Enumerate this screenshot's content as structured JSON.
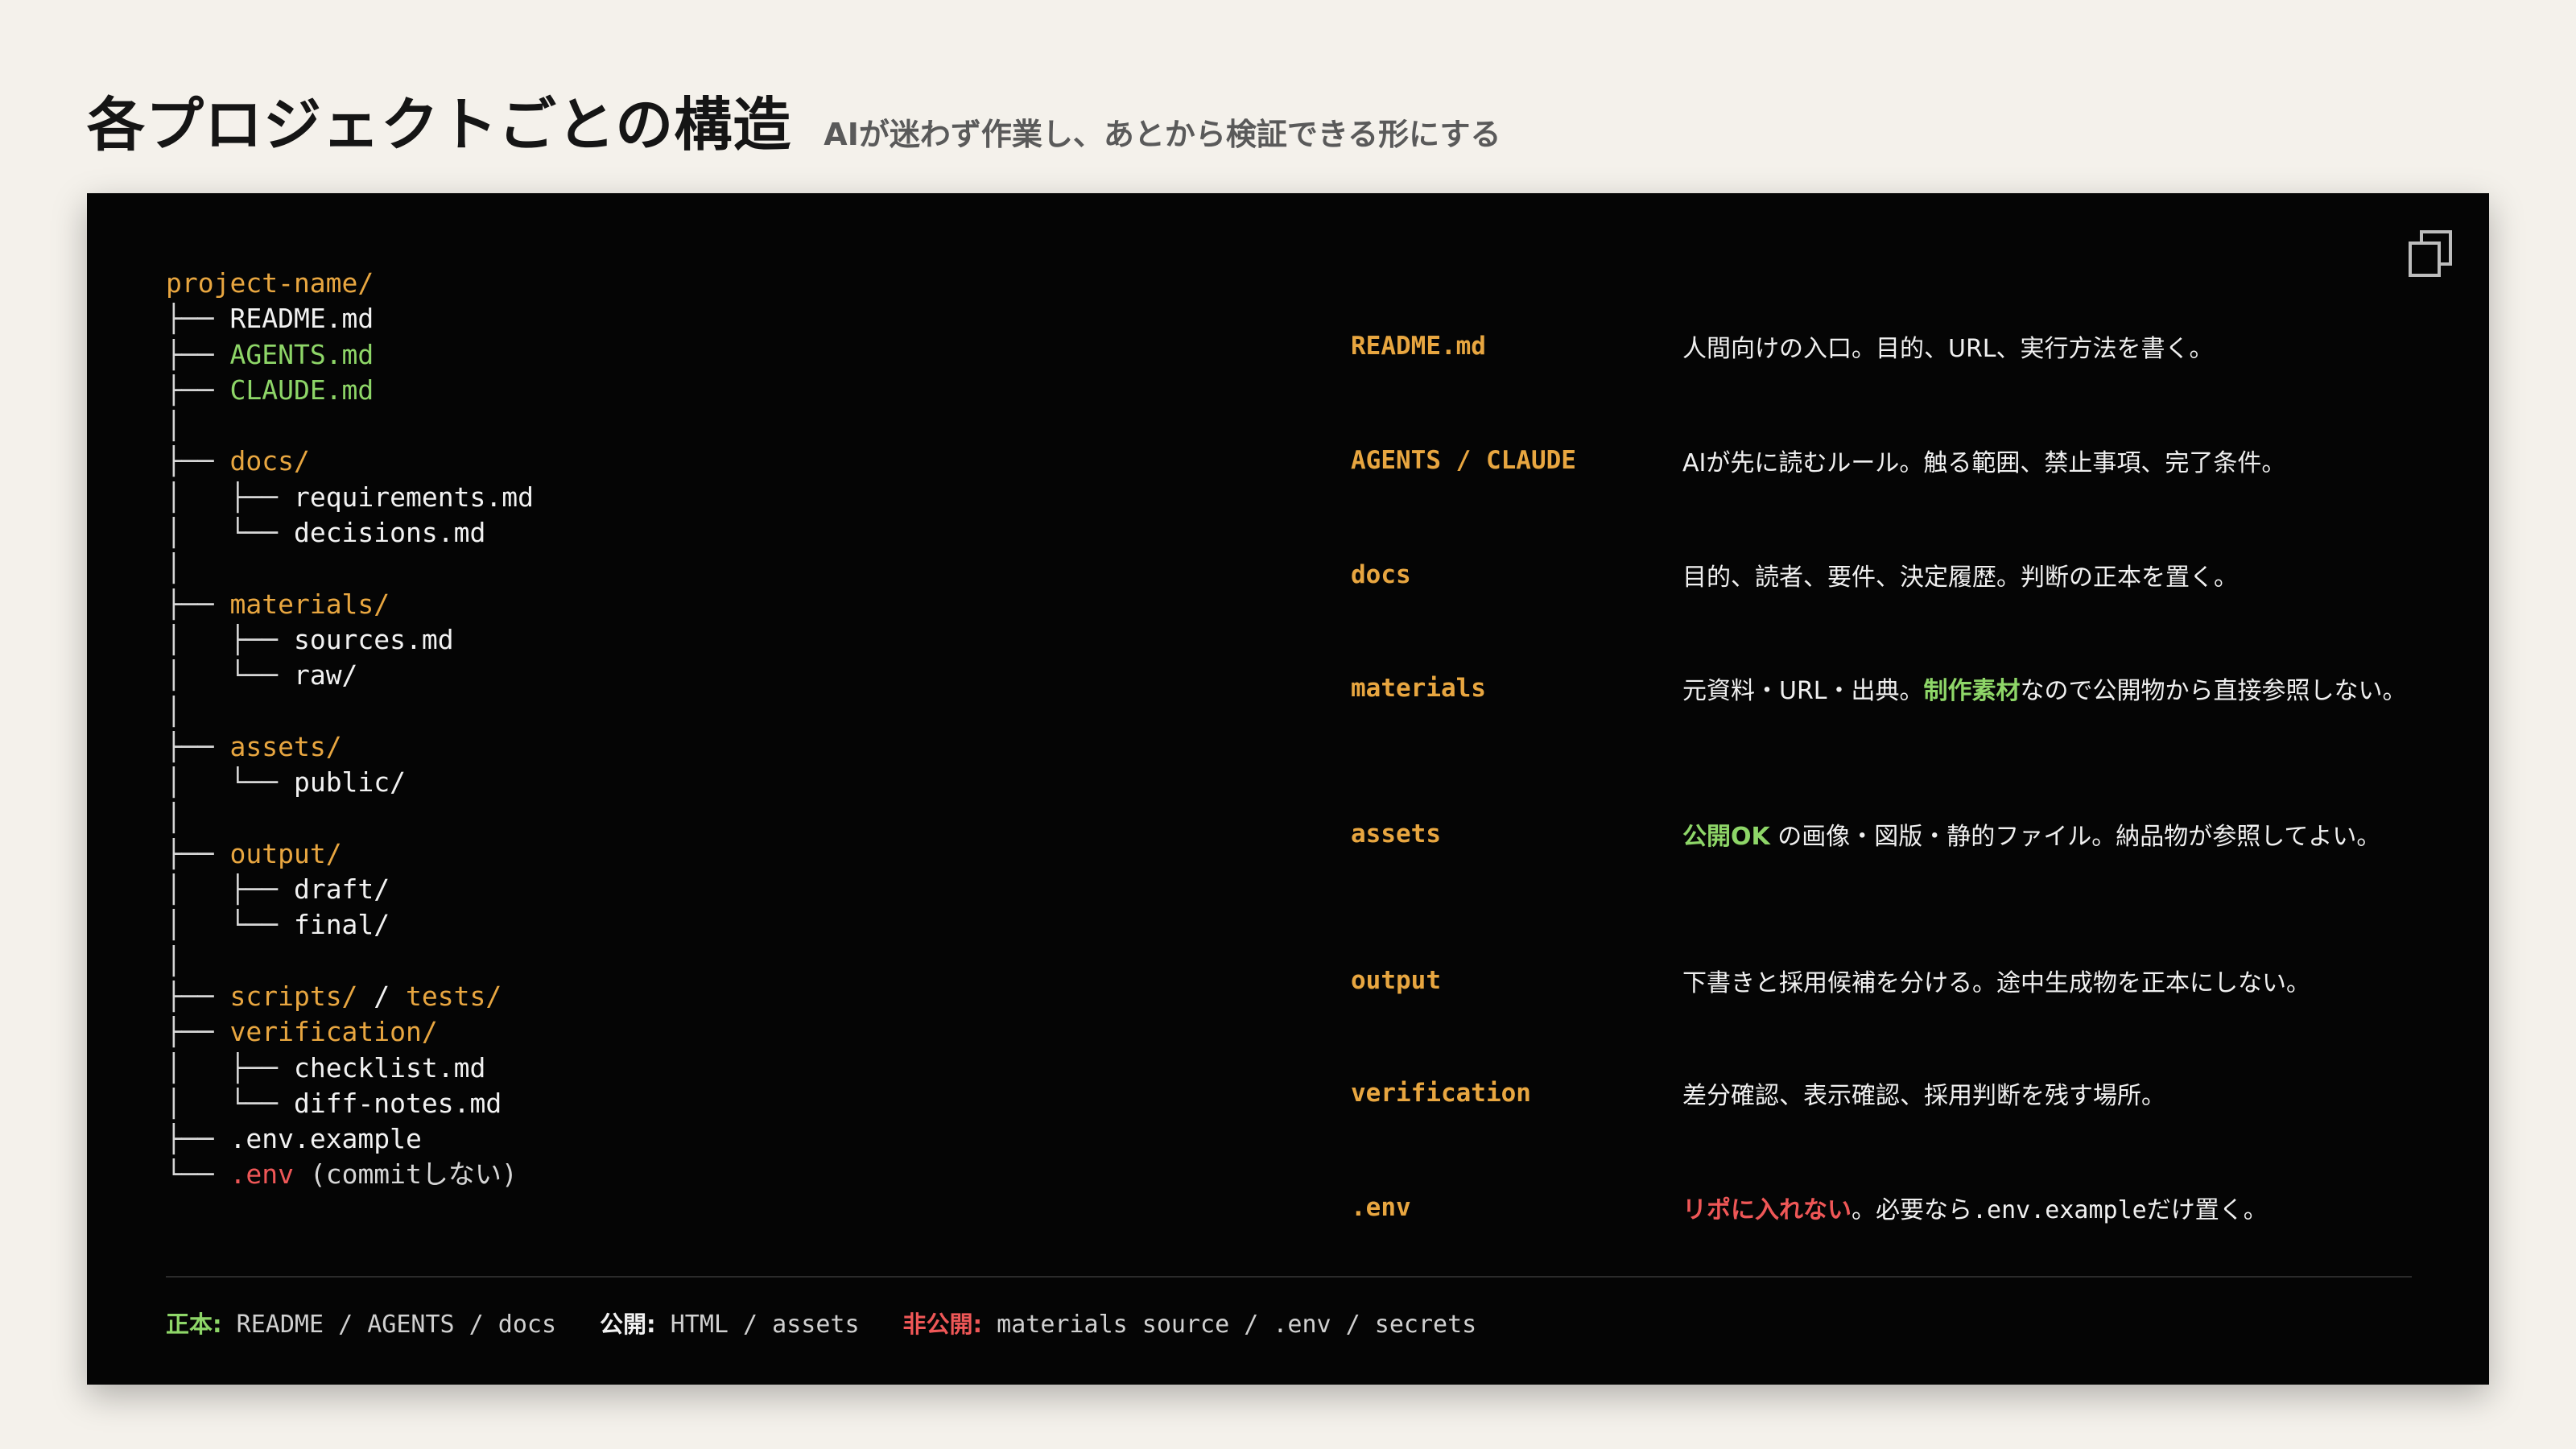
{
  "title": "各プロジェクトごとの構造",
  "subtitle": "AIが迷わず作業し、あとから検証できる形にする",
  "copy_icon": "copy-icon",
  "tree": [
    {
      "prefix": "",
      "name": "project-name/",
      "color": "orange"
    },
    {
      "prefix": "├── ",
      "name": "README.md",
      "color": "white"
    },
    {
      "prefix": "├── ",
      "name": "AGENTS.md",
      "color": "green"
    },
    {
      "prefix": "├── ",
      "name": "CLAUDE.md",
      "color": "green"
    },
    {
      "prefix": "│",
      "name": "",
      "color": "white"
    },
    {
      "prefix": "├── ",
      "name": "docs/",
      "color": "orange"
    },
    {
      "prefix": "│   ├── ",
      "name": "requirements.md",
      "color": "white"
    },
    {
      "prefix": "│   └── ",
      "name": "decisions.md",
      "color": "white"
    },
    {
      "prefix": "│",
      "name": "",
      "color": "white"
    },
    {
      "prefix": "├── ",
      "name": "materials/",
      "color": "orange"
    },
    {
      "prefix": "│   ├── ",
      "name": "sources.md",
      "color": "white"
    },
    {
      "prefix": "│   └── ",
      "name": "raw/",
      "color": "white"
    },
    {
      "prefix": "│",
      "name": "",
      "color": "white"
    },
    {
      "prefix": "├── ",
      "name": "assets/",
      "color": "orange"
    },
    {
      "prefix": "│   └── ",
      "name": "public/",
      "color": "white"
    },
    {
      "prefix": "│",
      "name": "",
      "color": "white"
    },
    {
      "prefix": "├── ",
      "name": "output/",
      "color": "orange"
    },
    {
      "prefix": "│   ├── ",
      "name": "draft/",
      "color": "white"
    },
    {
      "prefix": "│   └── ",
      "name": "final/",
      "color": "white"
    },
    {
      "prefix": "│",
      "name": "",
      "color": "white"
    },
    {
      "prefix": "├── ",
      "name": "scripts/",
      "color": "orange",
      "sep": " / ",
      "name2": "tests/"
    },
    {
      "prefix": "├── ",
      "name": "verification/",
      "color": "orange"
    },
    {
      "prefix": "│   ├── ",
      "name": "checklist.md",
      "color": "white"
    },
    {
      "prefix": "│   └── ",
      "name": "diff-notes.md",
      "color": "white"
    },
    {
      "prefix": "├── ",
      "name": ".env.example",
      "color": "white"
    },
    {
      "prefix": "└── ",
      "name": ".env",
      "color": "red",
      "suffix": " (commitしない)"
    }
  ],
  "descriptions": [
    {
      "key": "README.md",
      "parts": [
        {
          "t": "人間向けの入口。目的、URL、実行方法を書く。"
        }
      ]
    },
    {
      "key": "AGENTS / CLAUDE",
      "parts": [
        {
          "t": "AIが先に読むルール。触る範囲、禁止事項、完了条件。"
        }
      ]
    },
    {
      "key": "docs",
      "parts": [
        {
          "t": "目的、読者、要件、決定履歴。判断の正本を置く。"
        }
      ]
    },
    {
      "key": "materials",
      "parts": [
        {
          "t": "元資料・URL・出典。"
        },
        {
          "t": "制作素材",
          "s": "green"
        },
        {
          "t": "なので公開物から直接参照しない。"
        }
      ]
    },
    {
      "key": "assets",
      "parts": [
        {
          "t": "公開OK",
          "s": "green"
        },
        {
          "t": " の画像・図版・静的ファイル。納品物が参照してよい。"
        }
      ]
    },
    {
      "key": "output",
      "parts": [
        {
          "t": "下書きと採用候補を分ける。途中生成物を正本にしない。"
        }
      ]
    },
    {
      "key": "verification",
      "parts": [
        {
          "t": "差分確認、表示確認、採用判断を残す場所。"
        }
      ]
    },
    {
      "key": ".env",
      "parts": [
        {
          "t": "リポに入れない",
          "s": "red"
        },
        {
          "t": "。必要なら"
        },
        {
          "t": ".env.example",
          "s": "mono"
        },
        {
          "t": "だけ置く。"
        }
      ]
    }
  ],
  "footer": {
    "canonical_label": "正本:",
    "canonical_value": " README / AGENTS / docs",
    "public_label": "公開:",
    "public_value": " HTML / assets",
    "private_label": "非公開:",
    "private_value": " materials source / .env / secrets"
  },
  "colors": {
    "orange": "#e8a640",
    "green": "#8ed668",
    "red": "#ef5757",
    "white": "#f2f2f2",
    "panel_bg": "#050505",
    "page_bg": "#f4f1eb"
  }
}
